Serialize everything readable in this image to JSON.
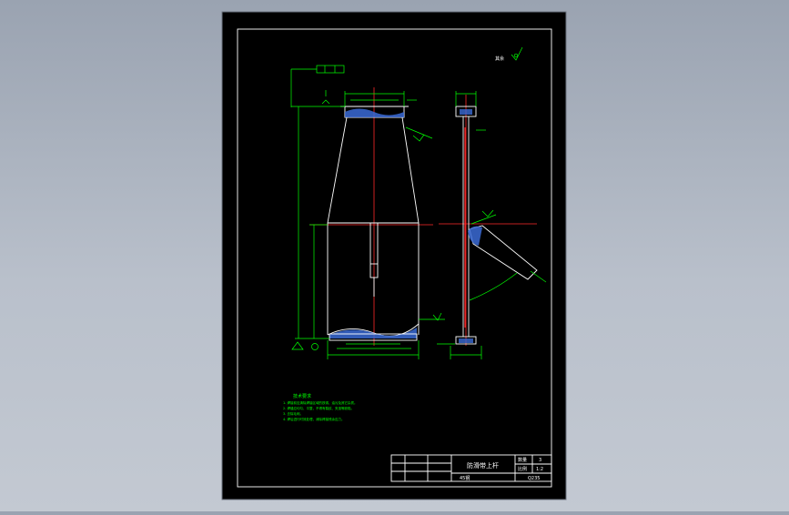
{
  "drawing": {
    "title": "防滑带上杆",
    "scale_label": "比例",
    "scale_value": "1:2",
    "count_label": "数量",
    "count_value": "3",
    "material": "45钢",
    "material_code": "Q235",
    "surface_mark": "其余"
  },
  "tech_requirements": {
    "heading": "技术要求",
    "lines": [
      "1. 焊接前应清除焊接区域的铁锈、油污及其它杂质。",
      "2. 焊缝应均匀、平整，不得有裂纹、夹渣等缺陷。",
      "3. 去除毛刺。",
      "4. 焊后进行时效处理，消除焊接残余应力。"
    ]
  },
  "colors": {
    "background": "#9aa3b1",
    "sheet": "#000000",
    "border": "#ffffff",
    "dimension": "#00ff00",
    "centerline": "#ff2a2a",
    "hatch": "#3b6bd6"
  }
}
